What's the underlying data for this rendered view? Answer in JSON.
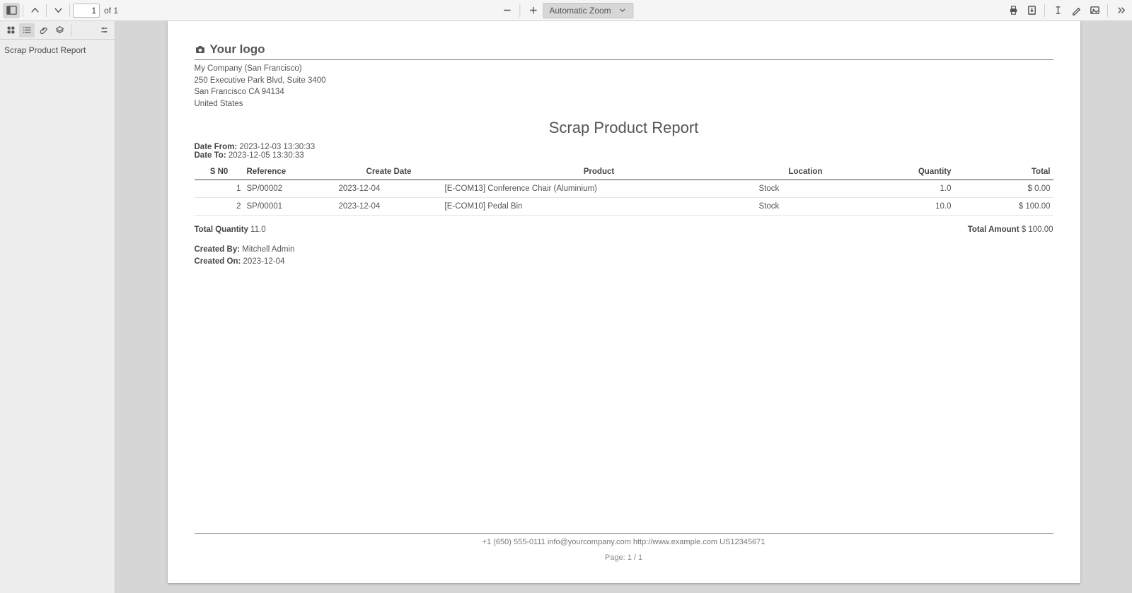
{
  "toolbar": {
    "page_current": "1",
    "page_of_label": "of",
    "page_total": "1",
    "zoom_label": "Automatic Zoom"
  },
  "sidebar": {
    "outline_item": "Scrap Product Report"
  },
  "report": {
    "logo_text": "Your logo",
    "company": {
      "name": "My Company (San Francisco)",
      "street": "250 Executive Park Blvd, Suite 3400",
      "city_line": "San Francisco CA 94134",
      "country": "United States"
    },
    "title": "Scrap Product Report",
    "date_from_label": "Date From:",
    "date_from": "2023-12-03 13:30:33",
    "date_to_label": "Date To:",
    "date_to": "2023-12-05 13:30:33",
    "columns": {
      "sno": "S N0",
      "reference": "Reference",
      "create_date": "Create Date",
      "product": "Product",
      "location": "Location",
      "quantity": "Quantity",
      "total": "Total"
    },
    "rows": [
      {
        "sno": "1",
        "reference": "SP/00002",
        "create_date": "2023-12-04",
        "product": "[E-COM13] Conference Chair (Aluminium)",
        "location": "Stock",
        "quantity": "1.0",
        "total": "$ 0.00"
      },
      {
        "sno": "2",
        "reference": "SP/00001",
        "create_date": "2023-12-04",
        "product": "[E-COM10] Pedal Bin",
        "location": "Stock",
        "quantity": "10.0",
        "total": "$ 100.00"
      }
    ],
    "total_quantity_label": "Total Quantity",
    "total_quantity": "11.0",
    "total_amount_label": "Total Amount",
    "total_amount": "$ 100.00",
    "created_by_label": "Created By:",
    "created_by": "Mitchell Admin",
    "created_on_label": "Created On:",
    "created_on": "2023-12-04",
    "footer_contact": "+1 (650) 555-0111 info@yourcompany.com http://www.example.com US12345671",
    "footer_page": "Page: 1 / 1"
  }
}
